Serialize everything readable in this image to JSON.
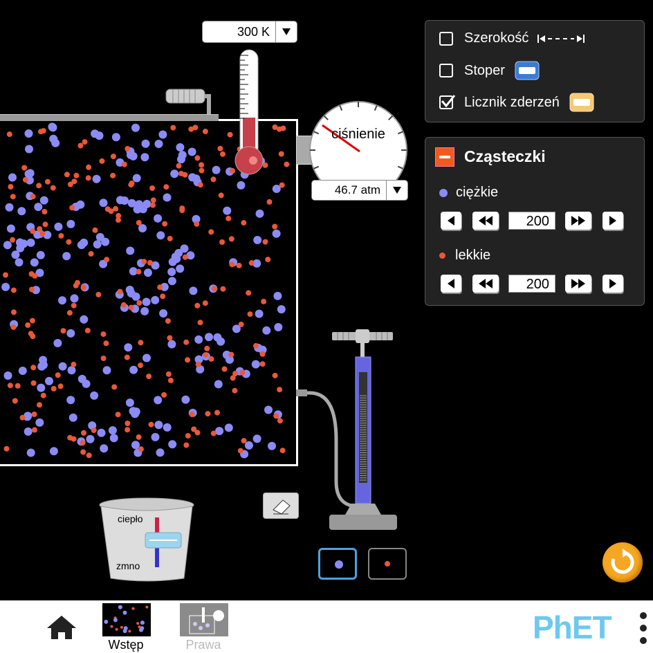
{
  "thermometer": {
    "value": "300 K"
  },
  "gauge": {
    "label": "ciśnienie",
    "value": "46.7 atm"
  },
  "tools": {
    "width": {
      "label": "Szerokość",
      "checked": false
    },
    "stopwatch": {
      "label": "Stoper",
      "checked": false
    },
    "collision_counter": {
      "label": "Licznik zderzeń",
      "checked": true
    }
  },
  "particles": {
    "title": "Cząsteczki",
    "heavy": {
      "label": "ciężkie",
      "count": "200",
      "color": "#8b8bf5"
    },
    "light": {
      "label": "lekkie",
      "count": "200",
      "color": "#e8583a"
    }
  },
  "bucket": {
    "heat_label": "ciepło",
    "cold_label": "zmno"
  },
  "nav": {
    "screens": [
      {
        "label": "Wstęp",
        "selected": true
      },
      {
        "label": "Prawa",
        "selected": false
      }
    ],
    "brand": "PhET"
  }
}
